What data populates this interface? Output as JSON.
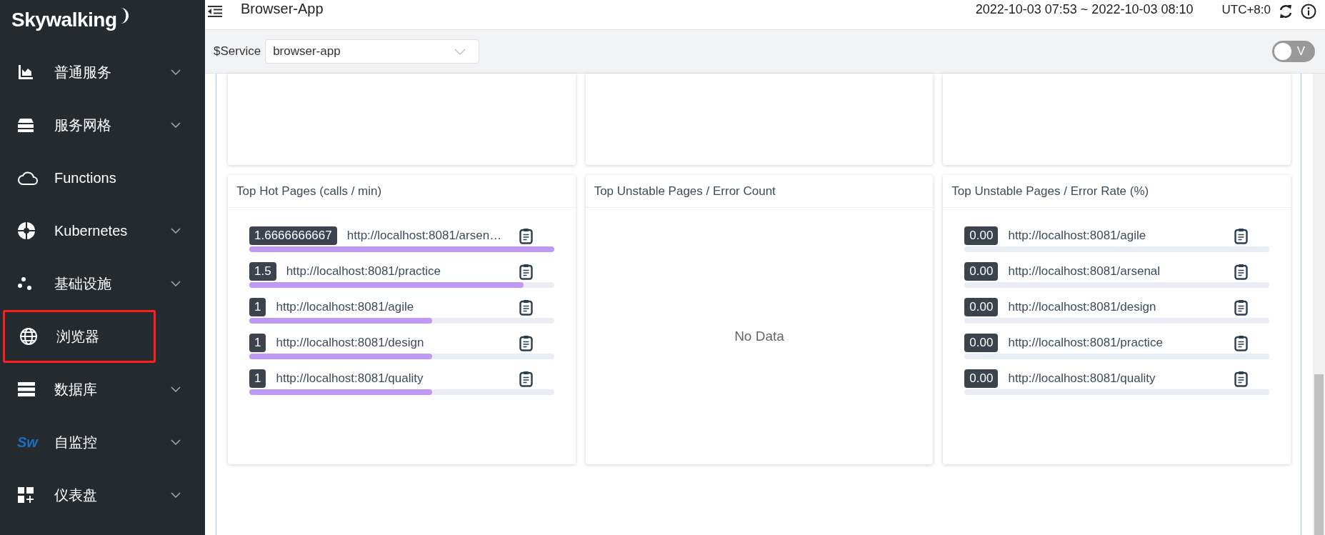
{
  "sidebar": {
    "brand": "Skywalking",
    "items": [
      {
        "label": "普通服务",
        "expandable": true,
        "annotated": false
      },
      {
        "label": "服务网格",
        "expandable": true,
        "annotated": false
      },
      {
        "label": "Functions",
        "expandable": false,
        "annotated": false
      },
      {
        "label": "Kubernetes",
        "expandable": true,
        "annotated": false
      },
      {
        "label": "基础设施",
        "expandable": true,
        "annotated": false
      },
      {
        "label": "浏览器",
        "expandable": false,
        "annotated": true
      },
      {
        "label": "数据库",
        "expandable": true,
        "annotated": false
      },
      {
        "label": "自监控",
        "expandable": true,
        "annotated": false,
        "logo_text": "Sw"
      },
      {
        "label": "仪表盘",
        "expandable": true,
        "annotated": false
      }
    ]
  },
  "header": {
    "title": "Browser-App",
    "time_range": "2022-10-03 07:53 ~ 2022-10-03 08:10",
    "timezone": "UTC+8:0"
  },
  "toolbar": {
    "service_label": "$Service",
    "service_value": "browser-app",
    "toggle": {
      "label": "V",
      "on": false
    }
  },
  "cards": [
    {
      "title": "Top Hot Pages (calls / min)",
      "rows": [
        {
          "value": "1.6666666667",
          "url": "http://localhost:8081/arsen…",
          "level": 1.0
        },
        {
          "value": "1.5",
          "url": "http://localhost:8081/practice",
          "level": 0.9
        },
        {
          "value": "1",
          "url": "http://localhost:8081/agile",
          "level": 0.6
        },
        {
          "value": "1",
          "url": "http://localhost:8081/design",
          "level": 0.6
        },
        {
          "value": "1",
          "url": "http://localhost:8081/quality",
          "level": 0.6
        }
      ]
    },
    {
      "title": "Top Unstable Pages / Error Count",
      "empty_text": "No Data"
    },
    {
      "title": "Top Unstable Pages / Error Rate (%)",
      "rows": [
        {
          "value": "0.00",
          "url": "http://localhost:8081/agile"
        },
        {
          "value": "0.00",
          "url": "http://localhost:8081/arsenal"
        },
        {
          "value": "0.00",
          "url": "http://localhost:8081/design"
        },
        {
          "value": "0.00",
          "url": "http://localhost:8081/practice"
        },
        {
          "value": "0.00",
          "url": "http://localhost:8081/quality"
        }
      ]
    }
  ]
}
